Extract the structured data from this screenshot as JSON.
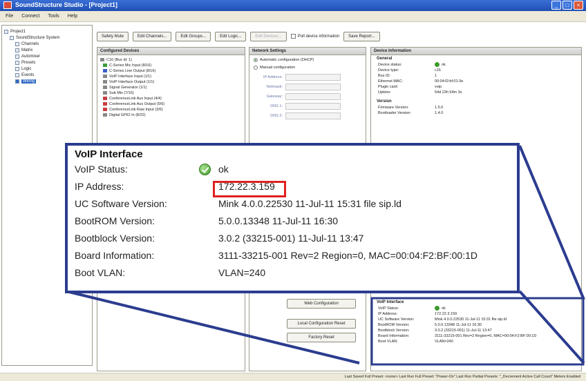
{
  "window": {
    "title": "SoundStructure Studio - [Project1]"
  },
  "menu": [
    "File",
    "Connect",
    "Tools",
    "Help"
  ],
  "tree": {
    "items": [
      {
        "label": "Project1",
        "indent": 0
      },
      {
        "label": "SoundStructure System",
        "indent": 1
      },
      {
        "label": "Channels",
        "indent": 2
      },
      {
        "label": "Matrix",
        "indent": 2
      },
      {
        "label": "Automixer",
        "indent": 2
      },
      {
        "label": "Presets",
        "indent": 2
      },
      {
        "label": "Logic",
        "indent": 2
      },
      {
        "label": "Events",
        "indent": 2
      },
      {
        "label": "Wiring",
        "indent": 2,
        "selected": true
      }
    ]
  },
  "toolbar": {
    "safety_mute": "Safety Mute",
    "edit_channels": "Edit Channels...",
    "edit_groups": "Edit Groups...",
    "edit_logic": "Edit Logic...",
    "edit_devices": "Edit Devices...",
    "poll_device": "Poll device information",
    "save_report": "Save Report..."
  },
  "devices_panel": {
    "title": "Configured Devices",
    "root": "C16 (Bus Id: 1)",
    "items": [
      {
        "label": "C-Series Mic Input (8/16)",
        "color": "green"
      },
      {
        "label": "C-Series Line Output (8/16)",
        "color": "blue"
      },
      {
        "label": "VoIP Interface Input (1/1)",
        "color": "gray"
      },
      {
        "label": "VoIP Interface Output (1/1)",
        "color": "gray"
      },
      {
        "label": "Signal Generator (1/1)",
        "color": "gray"
      },
      {
        "label": "Sub Mix (7/16)",
        "color": "gray"
      },
      {
        "label": "ConferenceLink Aux Input (4/4)",
        "color": "red"
      },
      {
        "label": "ConferenceLink Aux Output (5/6)",
        "color": "red"
      },
      {
        "label": "ConferenceLink Raw Input (3/6)",
        "color": "red"
      },
      {
        "label": "Digital GPIO In (8/22)",
        "color": "gray"
      }
    ]
  },
  "network_panel": {
    "title": "Network Settings",
    "auto": "Automatic configuration (DHCP)",
    "manual": "Manual configuration",
    "fields": [
      "IP Address:",
      "Netmask:",
      "Gateway:",
      "DNS 1:",
      "DNS 2:"
    ],
    "buttons": [
      "Web Configuration",
      "Local Configuration Reset",
      "Factory Reset"
    ]
  },
  "info_panel": {
    "title": "Device Information",
    "general_title": "General",
    "general": [
      {
        "k": "Device status:",
        "v": "ok"
      },
      {
        "k": "Device type:",
        "v": "c16"
      },
      {
        "k": "Bus ID:",
        "v": "1"
      },
      {
        "k": "Ethernet MAC:",
        "v": "00:04:f2:bf:01:3e"
      },
      {
        "k": "Plugin card:",
        "v": "voip"
      },
      {
        "k": "Uptime:",
        "v": "54d 23h 54m 3s"
      }
    ],
    "version_title": "Version",
    "version": [
      {
        "k": "Firmware Version:",
        "v": "1.5.0"
      },
      {
        "k": "Bootloader Version:",
        "v": "1.4.0"
      }
    ],
    "voip_title": "VoIP Interface",
    "voip": [
      {
        "k": "VoIP Status:",
        "v": "ok"
      },
      {
        "k": "IP Address:",
        "v": "172.22.3.159"
      },
      {
        "k": "UC Software Version:",
        "v": "Mink 4.0.0.22530 11-Jul-11 15:31 file sip.ld"
      },
      {
        "k": "BootROM Version:",
        "v": "5.0.0.13348 11-Jul-11 16:30"
      },
      {
        "k": "Bootblock Version:",
        "v": "3.0.2 (33215-001) 11-Jul-11 13:47"
      },
      {
        "k": "Board Information:",
        "v": "3111-33215-001 Rev=2 Region=0, MAC=00:04:F2:BF:00:1D"
      },
      {
        "k": "Boot VLAN:",
        "v": "VLAN=240"
      }
    ]
  },
  "callout": {
    "title": "VoIP Interface",
    "rows": [
      {
        "k": "VoIP Status:",
        "v": "ok"
      },
      {
        "k": "IP Address:",
        "v": "172.22.3.159"
      },
      {
        "k": "UC Software Version:",
        "v": "Mink 4.0.0.22530 11-Jul-11 15:31 file sip.ld"
      },
      {
        "k": "BootROM Version:",
        "v": "5.0.0.13348 11-Jul-11 16:30"
      },
      {
        "k": "Bootblock Version:",
        "v": "3.0.2 (33215-001) 11-Jul-11 13:47"
      },
      {
        "k": "Board Information:",
        "v": "3111-33215-001 Rev=2 Region=0, MAC=00:04:F2:BF:00:1D"
      },
      {
        "k": "Boot VLAN:",
        "v": "VLAN=240"
      }
    ]
  },
  "statusbar": "Last Saved Full Preset: <none>   Last Run Full Preset: \"Power-On\"   Last Run Partial Presets: \"_Decrement Active Call Count\"   Meters Enabled",
  "colors": {
    "callout_border": "#2b3c8f",
    "highlight": "#e02020",
    "titlebar": "#2a5dc4"
  }
}
